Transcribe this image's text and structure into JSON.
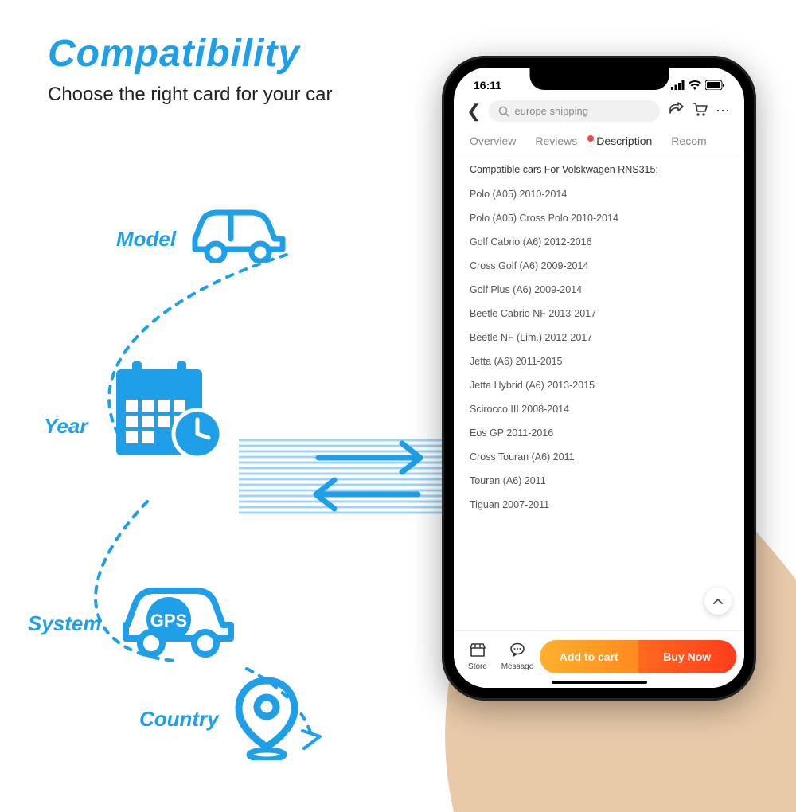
{
  "heading": {
    "title": "Compatibility",
    "subtitle": "Choose the right card for your car"
  },
  "orbit": {
    "model": "Model",
    "year": "Year",
    "system": "System",
    "country": "Country",
    "gps_badge": "GPS"
  },
  "phone": {
    "status": {
      "time": "16:11"
    },
    "search": {
      "placeholder": "europe shipping"
    },
    "tabs": {
      "overview": "Overview",
      "reviews": "Reviews",
      "description": "Description",
      "recommend": "Recom"
    },
    "content": {
      "header": "Compatible cars For Volskwagen RNS315:",
      "items": [
        "Polo (A05) 2010-2014",
        "Polo (A05) Cross Polo 2010-2014",
        "Golf Cabrio (A6) 2012-2016",
        "Cross Golf (A6) 2009-2014",
        "Golf Plus (A6) 2009-2014",
        "Beetle Cabrio NF 2013-2017",
        "Beetle NF (Lim.) 2012-2017",
        "Jetta (A6) 2011-2015",
        "Jetta Hybrid (A6) 2013-2015",
        "Scirocco III 2008-2014",
        "Eos GP 2011-2016",
        "Cross Touran (A6) 2011",
        "Touran (A6) 2011",
        "Tiguan 2007-2011"
      ]
    },
    "bottombar": {
      "store": "Store",
      "message": "Message",
      "add_to_cart": "Add to cart",
      "buy_now": "Buy Now"
    }
  },
  "colors": {
    "accent": "#1e9fe8"
  }
}
